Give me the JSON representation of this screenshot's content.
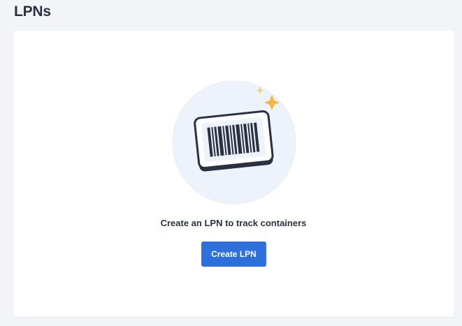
{
  "header": {
    "title": "LPNs"
  },
  "empty_state": {
    "illustration_icon": "barcode-label-icon",
    "message": "Create an LPN to track containers",
    "create_button_label": "Create LPN"
  },
  "colors": {
    "primary": "#2d6fdb",
    "sparkle": "#f6b93b",
    "illustration_bg": "#eef3fb",
    "label_outline": "#2a3142"
  }
}
